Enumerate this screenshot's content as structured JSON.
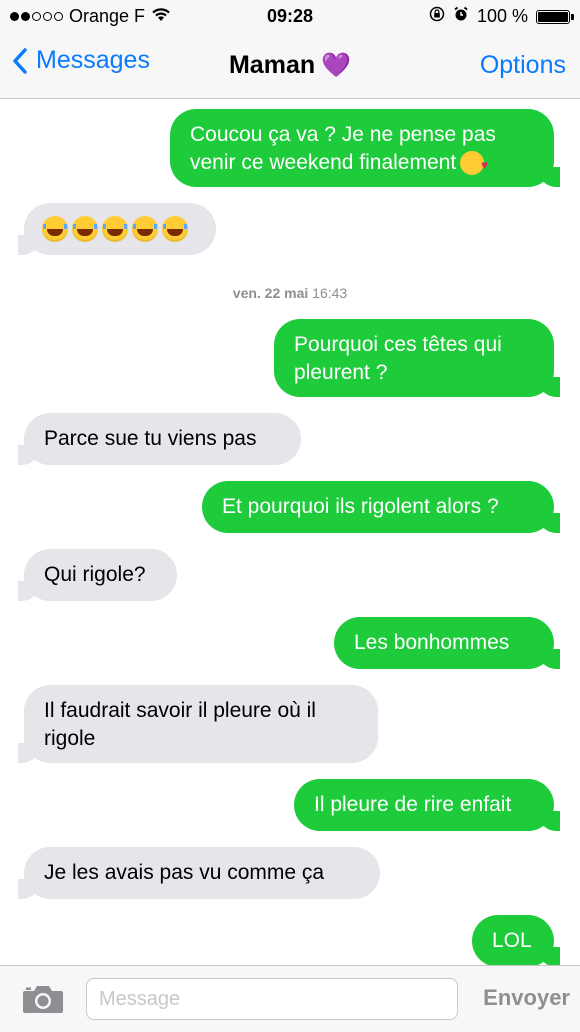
{
  "status_bar": {
    "carrier": "Orange F",
    "time": "09:28",
    "battery": "100 %",
    "battery_level": 1.0,
    "signal_bars": 2,
    "icons": [
      "signal-dots-icon",
      "wifi-icon",
      "orientation-lock-icon",
      "alarm-icon",
      "battery-icon"
    ]
  },
  "nav": {
    "back_label": "Messages",
    "title": "Maman",
    "title_emoji": "💜",
    "options_label": "Options"
  },
  "thread": {
    "messages": [
      {
        "from": "me",
        "text": "Coucou ça va ? Je ne pense pas venir ce weekend finalement",
        "emoji": "face-throwing-kiss"
      },
      {
        "from": "them",
        "text": "",
        "emoji": "face-with-tears-of-joy",
        "emoji_count": 5
      },
      {
        "from": "me",
        "text": "Pourquoi ces têtes qui pleurent ?"
      },
      {
        "from": "them",
        "text": "Parce sue tu viens pas"
      },
      {
        "from": "me",
        "text": "Et pourquoi ils rigolent alors ?"
      },
      {
        "from": "them",
        "text": "Qui rigole?"
      },
      {
        "from": "me",
        "text": "Les bonhommes"
      },
      {
        "from": "them",
        "text": "Il faudrait savoir il pleure où il rigole"
      },
      {
        "from": "me",
        "text": "Il pleure de rire enfait"
      },
      {
        "from": "them",
        "text": "Je les avais pas vu comme ça"
      },
      {
        "from": "me",
        "text": "LOL"
      }
    ],
    "timestamp": {
      "day": "ven. 22 mai",
      "time": "16:43"
    }
  },
  "input": {
    "placeholder": "Message",
    "send_label": "Envoyer"
  },
  "colors": {
    "outgoing": "#1ecb3b",
    "incoming": "#e5e5ea",
    "accent": "#0a7aff",
    "bar": "#f7f7f7"
  }
}
